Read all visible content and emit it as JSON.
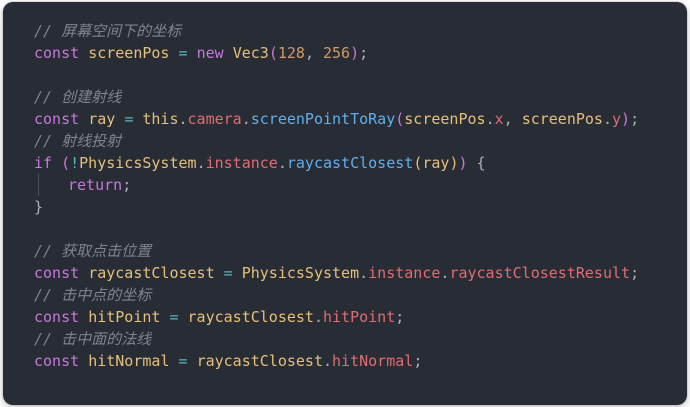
{
  "editor": {
    "lines": [
      [
        {
          "t": "// 屏幕空间下的坐标",
          "c": "comment"
        }
      ],
      [
        {
          "t": "const",
          "c": "keyword"
        },
        {
          "t": " ",
          "c": "punc"
        },
        {
          "t": "screenPos",
          "c": "var"
        },
        {
          "t": " ",
          "c": "punc"
        },
        {
          "t": "=",
          "c": "op"
        },
        {
          "t": " ",
          "c": "punc"
        },
        {
          "t": "new",
          "c": "keyword"
        },
        {
          "t": " ",
          "c": "punc"
        },
        {
          "t": "Vec3",
          "c": "class"
        },
        {
          "t": "(",
          "c": "paren"
        },
        {
          "t": "128",
          "c": "num"
        },
        {
          "t": ", ",
          "c": "punc"
        },
        {
          "t": "256",
          "c": "num"
        },
        {
          "t": ")",
          "c": "paren"
        },
        {
          "t": ";",
          "c": "punc"
        }
      ],
      [],
      [
        {
          "t": "// 创建射线",
          "c": "comment"
        }
      ],
      [
        {
          "t": "const",
          "c": "keyword"
        },
        {
          "t": " ",
          "c": "punc"
        },
        {
          "t": "ray",
          "c": "var"
        },
        {
          "t": " ",
          "c": "punc"
        },
        {
          "t": "=",
          "c": "op"
        },
        {
          "t": " ",
          "c": "punc"
        },
        {
          "t": "this",
          "c": "this"
        },
        {
          "t": ".",
          "c": "punc"
        },
        {
          "t": "camera",
          "c": "prop"
        },
        {
          "t": ".",
          "c": "punc"
        },
        {
          "t": "screenPointToRay",
          "c": "func"
        },
        {
          "t": "(",
          "c": "paren"
        },
        {
          "t": "screenPos",
          "c": "ident"
        },
        {
          "t": ".",
          "c": "punc"
        },
        {
          "t": "x",
          "c": "prop"
        },
        {
          "t": ", ",
          "c": "punc"
        },
        {
          "t": "screenPos",
          "c": "ident"
        },
        {
          "t": ".",
          "c": "punc"
        },
        {
          "t": "y",
          "c": "prop"
        },
        {
          "t": ")",
          "c": "paren"
        },
        {
          "t": ";",
          "c": "punc"
        }
      ],
      [
        {
          "t": "// 射线投射",
          "c": "comment"
        }
      ],
      [
        {
          "t": "if",
          "c": "keyword"
        },
        {
          "t": " ",
          "c": "punc"
        },
        {
          "t": "(",
          "c": "paren"
        },
        {
          "t": "!",
          "c": "op"
        },
        {
          "t": "PhysicsSystem",
          "c": "class"
        },
        {
          "t": ".",
          "c": "punc"
        },
        {
          "t": "instance",
          "c": "prop"
        },
        {
          "t": ".",
          "c": "punc"
        },
        {
          "t": "raycastClosest",
          "c": "func"
        },
        {
          "t": "(",
          "c": "paren2"
        },
        {
          "t": "ray",
          "c": "ident"
        },
        {
          "t": ")",
          "c": "paren2"
        },
        {
          "t": ")",
          "c": "paren"
        },
        {
          "t": " {",
          "c": "punc"
        }
      ],
      [
        {
          "t": "return",
          "c": "ret"
        },
        {
          "t": ";",
          "c": "punc"
        }
      ],
      [
        {
          "t": "}",
          "c": "punc"
        }
      ],
      [],
      [
        {
          "t": "// 获取点击位置",
          "c": "comment"
        }
      ],
      [
        {
          "t": "const",
          "c": "keyword"
        },
        {
          "t": " ",
          "c": "punc"
        },
        {
          "t": "raycastClosest",
          "c": "var"
        },
        {
          "t": " ",
          "c": "punc"
        },
        {
          "t": "=",
          "c": "op"
        },
        {
          "t": " ",
          "c": "punc"
        },
        {
          "t": "PhysicsSystem",
          "c": "class"
        },
        {
          "t": ".",
          "c": "punc"
        },
        {
          "t": "instance",
          "c": "prop"
        },
        {
          "t": ".",
          "c": "punc"
        },
        {
          "t": "raycastClosestResult",
          "c": "prop"
        },
        {
          "t": ";",
          "c": "punc"
        }
      ],
      [
        {
          "t": "// 击中点的坐标",
          "c": "comment"
        }
      ],
      [
        {
          "t": "const",
          "c": "keyword"
        },
        {
          "t": " ",
          "c": "punc"
        },
        {
          "t": "hitPoint",
          "c": "var"
        },
        {
          "t": " ",
          "c": "punc"
        },
        {
          "t": "=",
          "c": "op"
        },
        {
          "t": " ",
          "c": "punc"
        },
        {
          "t": "raycastClosest",
          "c": "ident"
        },
        {
          "t": ".",
          "c": "punc"
        },
        {
          "t": "hitPoint",
          "c": "prop"
        },
        {
          "t": ";",
          "c": "punc"
        }
      ],
      [
        {
          "t": "// 击中面的法线",
          "c": "comment"
        }
      ],
      [
        {
          "t": "const",
          "c": "keyword"
        },
        {
          "t": " ",
          "c": "punc"
        },
        {
          "t": "hitNormal",
          "c": "var"
        },
        {
          "t": " ",
          "c": "punc"
        },
        {
          "t": "=",
          "c": "op"
        },
        {
          "t": " ",
          "c": "punc"
        },
        {
          "t": "raycastClosest",
          "c": "ident"
        },
        {
          "t": ".",
          "c": "punc"
        },
        {
          "t": "hitNormal",
          "c": "prop"
        },
        {
          "t": ";",
          "c": "punc"
        }
      ]
    ],
    "indented_lines": [
      7
    ],
    "theme": {
      "background": "#282c34",
      "comment": "#7f848e",
      "keyword": "#c678dd",
      "variable": "#e5c07b",
      "property": "#e06c75",
      "function": "#61afef",
      "number": "#d19a66",
      "operator": "#56b6c2"
    }
  }
}
